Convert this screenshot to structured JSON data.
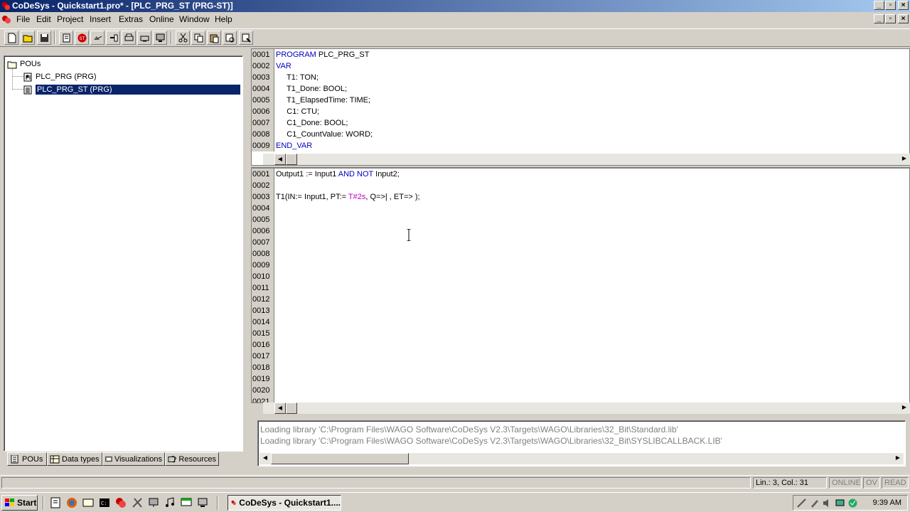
{
  "window": {
    "title": "CoDeSys - Quickstart1.pro* - [PLC_PRG_ST (PRG-ST)]",
    "controls": [
      "minimize",
      "restore",
      "close"
    ]
  },
  "menu": {
    "items": [
      "File",
      "Edit",
      "Project",
      "Insert",
      "Extras",
      "Online",
      "Window",
      "Help"
    ]
  },
  "toolbar": {
    "buttons": [
      "new",
      "open",
      "save",
      "rebuild-all",
      "stop",
      "login",
      "logout",
      "run",
      "step",
      "print",
      "find",
      "cut",
      "copy",
      "paste",
      "find-next",
      "replace"
    ]
  },
  "tree": {
    "root": "POUs",
    "items": [
      {
        "label": "PLC_PRG (PRG)",
        "selected": false
      },
      {
        "label": "PLC_PRG_ST (PRG)",
        "selected": true
      }
    ]
  },
  "object_tabs": [
    "POUs",
    "Data types",
    "Visualizations",
    "Resources"
  ],
  "declaration": {
    "lines": [
      {
        "num": "0001",
        "parts": [
          {
            "t": "PROGRAM ",
            "c": "kw"
          },
          {
            "t": "PLC_PRG_ST",
            "c": ""
          }
        ]
      },
      {
        "num": "0002",
        "parts": [
          {
            "t": "VAR",
            "c": "kw"
          }
        ]
      },
      {
        "num": "0003",
        "parts": [
          {
            "t": "     T1: TON;",
            "c": ""
          }
        ]
      },
      {
        "num": "0004",
        "parts": [
          {
            "t": "     T1_Done: BOOL;",
            "c": ""
          }
        ]
      },
      {
        "num": "0005",
        "parts": [
          {
            "t": "     T1_ElapsedTime: TIME;",
            "c": ""
          }
        ]
      },
      {
        "num": "0006",
        "parts": [
          {
            "t": "     C1: CTU;",
            "c": ""
          }
        ]
      },
      {
        "num": "0007",
        "parts": [
          {
            "t": "     C1_Done: BOOL;",
            "c": ""
          }
        ]
      },
      {
        "num": "0008",
        "parts": [
          {
            "t": "     C1_CountValue: WORD;",
            "c": ""
          }
        ]
      },
      {
        "num": "0009",
        "parts": [
          {
            "t": "END_VAR",
            "c": "kw"
          }
        ]
      }
    ]
  },
  "body": {
    "lines": [
      {
        "num": "0001",
        "parts": [
          {
            "t": "Output1 := Input1 ",
            "c": ""
          },
          {
            "t": "AND NOT",
            "c": "kw"
          },
          {
            "t": " Input2;",
            "c": ""
          }
        ]
      },
      {
        "num": "0002",
        "parts": []
      },
      {
        "num": "0003",
        "parts": [
          {
            "t": "T1(IN:= Input1, PT:= ",
            "c": ""
          },
          {
            "t": "T#2s",
            "c": "lit"
          },
          {
            "t": ", Q=>| , ET=> );",
            "c": ""
          }
        ]
      },
      {
        "num": "0004",
        "parts": []
      },
      {
        "num": "0005",
        "parts": []
      },
      {
        "num": "0006",
        "parts": []
      },
      {
        "num": "0007",
        "parts": []
      },
      {
        "num": "0008",
        "parts": []
      },
      {
        "num": "0009",
        "parts": []
      },
      {
        "num": "0010",
        "parts": []
      },
      {
        "num": "0011",
        "parts": []
      },
      {
        "num": "0012",
        "parts": []
      },
      {
        "num": "0013",
        "parts": []
      },
      {
        "num": "0014",
        "parts": []
      },
      {
        "num": "0015",
        "parts": []
      },
      {
        "num": "0016",
        "parts": []
      },
      {
        "num": "0017",
        "parts": []
      },
      {
        "num": "0018",
        "parts": []
      },
      {
        "num": "0019",
        "parts": []
      },
      {
        "num": "0020",
        "parts": []
      },
      {
        "num": "0021",
        "parts": []
      }
    ]
  },
  "messages": [
    "Loading library 'C:\\Program Files\\WAGO Software\\CoDeSys V2.3\\Targets\\WAGO\\Libraries\\32_Bit\\Standard.lib'",
    "Loading library 'C:\\Program Files\\WAGO Software\\CoDeSys V2.3\\Targets\\WAGO\\Libraries\\32_Bit\\SYSLIBCALLBACK.LIB'"
  ],
  "status": {
    "position": "Lin.: 3, Col.: 31",
    "online": "ONLINE",
    "ov": "OV",
    "read": "READ"
  },
  "taskbar": {
    "start": "Start",
    "task": "CoDeSys - Quickstart1....",
    "clock": "9:39 AM"
  },
  "colors": {
    "keyword": "#0000c0",
    "literal": "#c000c0",
    "selection": "#0a246a",
    "title_gradient_start": "#0a246a",
    "title_gradient_end": "#a6caf0"
  }
}
